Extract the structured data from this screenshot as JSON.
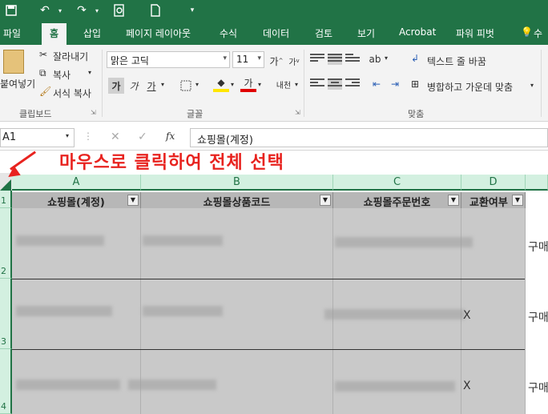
{
  "colors": {
    "excel_green": "#217346",
    "annotation_red": "#e8231f"
  },
  "quick_access": {
    "save_icon": "save-icon",
    "undo_icon": "undo-icon",
    "redo_icon": "redo-icon",
    "preview_icon": "print-preview-icon",
    "new_icon": "new-file-icon"
  },
  "tabs": [
    "파일",
    "홈",
    "삽입",
    "페이지 레이아웃",
    "수식",
    "데이터",
    "검토",
    "보기",
    "Acrobat",
    "파워 피벗",
    "수"
  ],
  "ribbon": {
    "clipboard": {
      "paste": "붙여넣기",
      "cut": "잘라내기",
      "copy": "복사",
      "format_painter": "서식 복사",
      "label": "클립보드"
    },
    "font": {
      "name": "맑은 고딕",
      "size": "11",
      "bold": "가",
      "italic": "가",
      "underline": "가",
      "grow": "가",
      "shrink": "가",
      "color_a": "가",
      "phonetic": "내천",
      "label": "글꼴"
    },
    "alignment": {
      "wrap_text": "텍스트 줄 바꿈",
      "merge_center": "병합하고 가운데 맞춤",
      "label": "맞춤"
    }
  },
  "formula_bar": {
    "name_box": "A1",
    "cancel": "✕",
    "enter": "✓",
    "fx": "fx",
    "content": "쇼핑몰(계정)"
  },
  "sheet": {
    "columns": [
      "A",
      "B",
      "C",
      "D"
    ],
    "rows": [
      "1",
      "2",
      "3",
      "4"
    ],
    "headers": [
      "쇼핑몰(계정)",
      "쇼핑몰상품코드",
      "쇼핑몰주문번호",
      "교환여부"
    ],
    "column_d_values": [
      "",
      "X",
      "X"
    ],
    "column_e_values": [
      "구매",
      "구매",
      "구매"
    ]
  },
  "annotation": "마우스로 클릭하여 전체 선택"
}
